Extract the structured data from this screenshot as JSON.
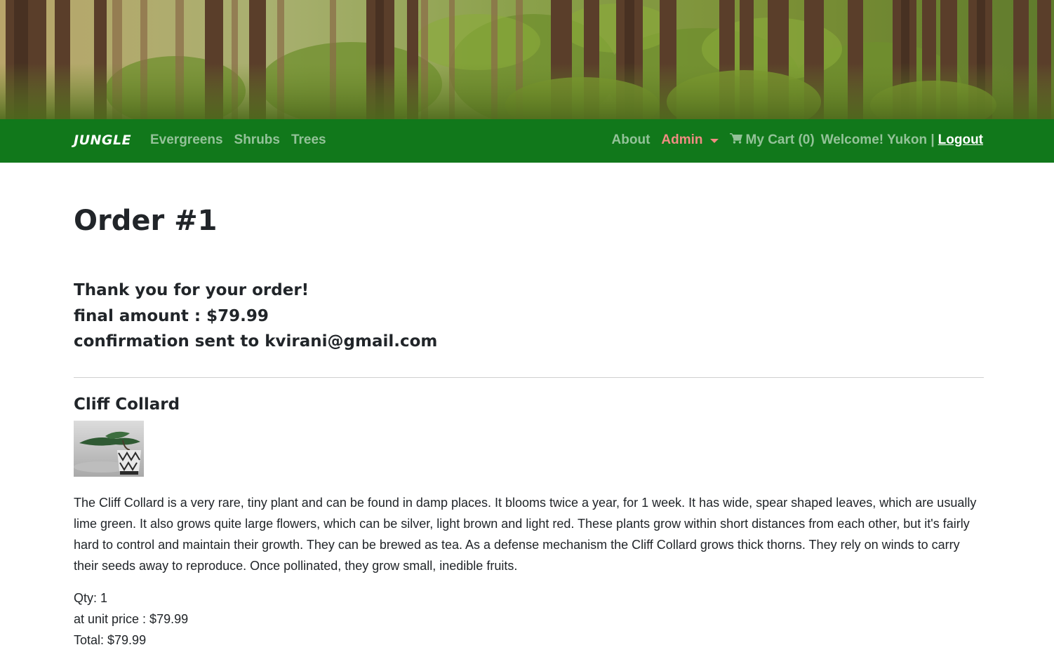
{
  "nav": {
    "brand": "JUNGLE",
    "left_links": [
      "Evergreens",
      "Shrubs",
      "Trees"
    ],
    "about": "About",
    "admin": "Admin",
    "cart_label": "My Cart (0)",
    "welcome": "Welcome! Yukon |",
    "logout": "Logout"
  },
  "icons": {
    "cart": "shopping-cart-icon",
    "admin_caret": "caret-down-icon"
  },
  "colors": {
    "navbar": "#11781b",
    "admin_link": "#f08c82"
  },
  "order": {
    "title": "Order #1",
    "thank_you": "Thank you for your order!",
    "final_amount": "final amount : $79.99",
    "confirmation": "confirmation sent to kvirani@gmail.com"
  },
  "item": {
    "name": "Cliff Collard",
    "description": "The Cliff Collard is a very rare, tiny plant and can be found in damp places. It blooms twice a year, for 1 week. It has wide, spear shaped leaves, which are usually lime green. It also grows quite large flowers, which can be silver, light brown and light red. These plants grow within short distances from each other, but it's fairly hard to control and maintain their growth. They can be brewed as tea. As a defense mechanism the Cliff Collard grows thick thorns. They rely on winds to carry their seeds away to reproduce. Once pollinated, they grow small, inedible fruits.",
    "qty": "Qty: 1",
    "unit_price": "at unit price : $79.99",
    "total": "Total: $79.99"
  }
}
